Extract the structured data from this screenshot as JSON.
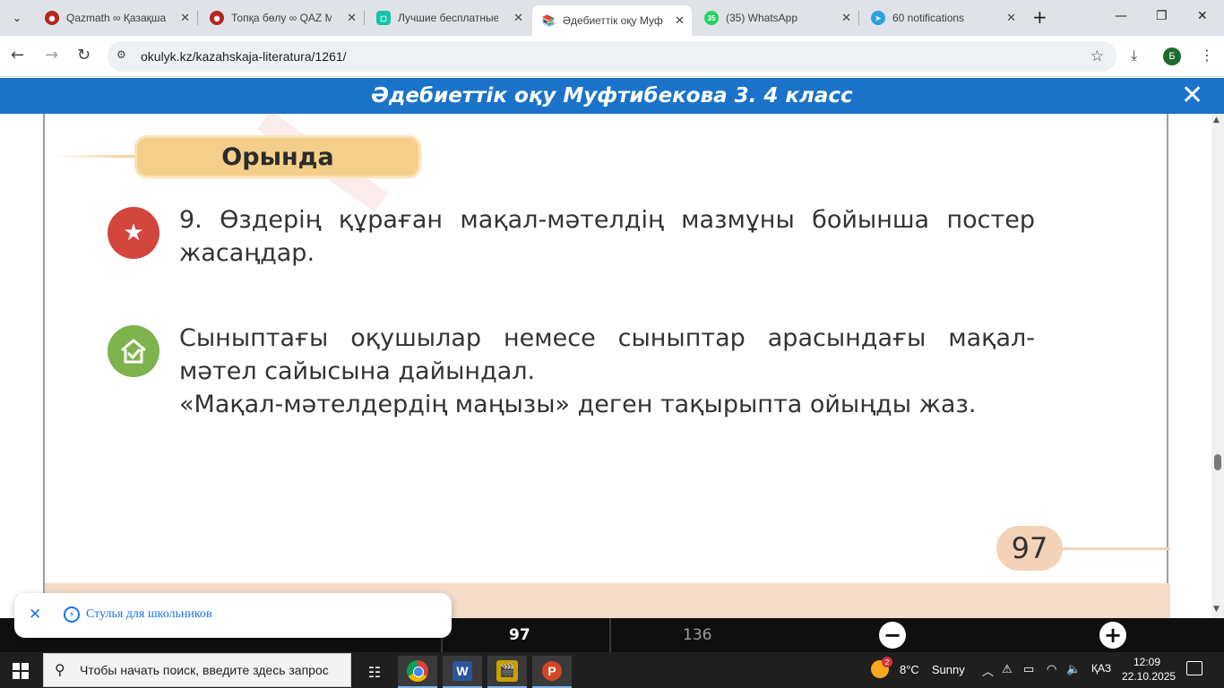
{
  "browser": {
    "tabs": [
      {
        "title": "Qazmath ∞ Қазақша",
        "favicon_color": "#b3261e",
        "active": false
      },
      {
        "title": "Топқа бөлу ∞ QAZ M",
        "favicon_color": "#b3261e",
        "active": false
      },
      {
        "title": "Лучшие бесплатные",
        "favicon_color": "#19c3a7",
        "active": false
      },
      {
        "title": "Әдебиеттік оқу Муф",
        "favicon_color": "#5f6368",
        "active": true
      },
      {
        "title": "(35) WhatsApp",
        "favicon_color": "#25d366",
        "badge": "35",
        "active": false
      },
      {
        "title": "60 notifications",
        "favicon_color": "#2aa3df",
        "active": false
      }
    ],
    "address": "okulyk.kz/kazahskaja-literatura/1261/",
    "profile_initial": "Б"
  },
  "reader": {
    "title": "Әдебиеттік оқу Муфтибекова 3. 4 класс",
    "close_glyph": "✕"
  },
  "page": {
    "section_label": "Орында",
    "task9": "9. Өздерің құраған мақал-мәтелдің мазмұны бойынша постер жасаңдар.",
    "home_task_line1": "Сыныптағы оқушылар немесе сыныптар арасындағы мақал-мәтел сайысына дайындал.",
    "home_task_line2": "«Мақал-мәтелдердің маңызы» деген тақырыпта ойыңды жаз.",
    "page_number": "97"
  },
  "controls": {
    "current_page": "97",
    "total_pages": "136"
  },
  "toast": {
    "text": "Стулья для школьников"
  },
  "taskbar": {
    "search_placeholder": "Чтобы начать поиск, введите здесь запрос",
    "weather_temp": "8°C",
    "weather_text": "Sunny",
    "weather_badge": "2",
    "language": "ҚАЗ",
    "time": "12:09",
    "date": "22.10.2025"
  },
  "colors": {
    "reader_header": "#1a73c9",
    "section_label_bg": "#f5cf8a",
    "task_icon_red": "#d2463e",
    "task_icon_green": "#7db34c"
  }
}
